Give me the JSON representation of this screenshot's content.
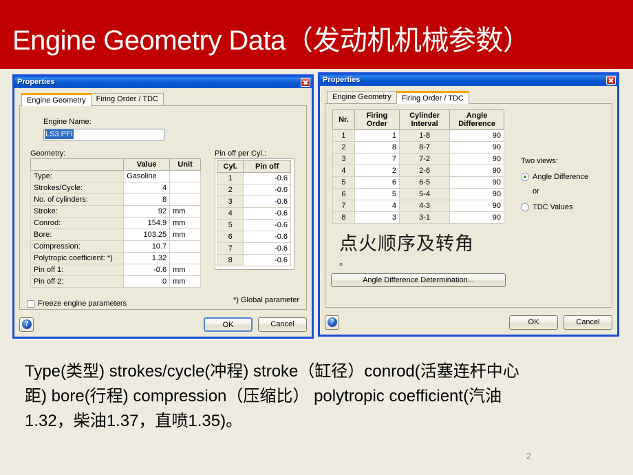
{
  "slide": {
    "title": "Engine Geometry Data（发动机机械参数）",
    "title_color": "#FFFFFF",
    "header_color": "#C00000",
    "background_color": "#EEEBE1",
    "page_number": "2",
    "caption": "Type(类型)  strokes/cycle(冲程) stroke（缸径）conrod(活塞连杆中心距) bore(行程) compression（压缩比） polytropic coefficient(汽油1.32，柴油1.37，直喷1.35)。"
  },
  "left_dialog": {
    "title": "Properties",
    "close_icon": "close-icon",
    "tabs": [
      {
        "label": "Engine Geometry",
        "active": true
      },
      {
        "label": "Firing Order / TDC",
        "active": false
      }
    ],
    "engine_name": {
      "label": "Engine Name:",
      "value": "LS3 PFI",
      "placeholder": ""
    },
    "geometry": {
      "label": "Geometry:",
      "headers": [
        "",
        "Value",
        "Unit"
      ],
      "rows": [
        {
          "name": "Type:",
          "value": "Gasoline",
          "unit": "",
          "value_align": "left"
        },
        {
          "name": "Strokes/Cycle:",
          "value": "4",
          "unit": ""
        },
        {
          "name": "No. of cylinders:",
          "value": "8",
          "unit": ""
        },
        {
          "name": "Stroke:",
          "value": "92",
          "unit": "mm"
        },
        {
          "name": "Conrod:",
          "value": "154.9",
          "unit": "mm"
        },
        {
          "name": "Bore:",
          "value": "103.25",
          "unit": "mm"
        },
        {
          "name": "Compression:",
          "value": "10.7",
          "unit": ""
        },
        {
          "name": "Polytropic coefficient: *)",
          "value": "1.32",
          "unit": ""
        },
        {
          "name": "Pin off 1:",
          "value": "-0.6",
          "unit": "mm"
        },
        {
          "name": "Pin off 2:",
          "value": "0",
          "unit": "mm"
        }
      ]
    },
    "pin_off": {
      "label": "Pin off per Cyl.:",
      "headers": [
        "Cyl.",
        "Pin off"
      ],
      "rows": [
        {
          "cyl": "1",
          "pin_off": "-0.6"
        },
        {
          "cyl": "2",
          "pin_off": "-0.6"
        },
        {
          "cyl": "3",
          "pin_off": "-0.6"
        },
        {
          "cyl": "4",
          "pin_off": "-0.6"
        },
        {
          "cyl": "5",
          "pin_off": "-0.6"
        },
        {
          "cyl": "6",
          "pin_off": "-0.6"
        },
        {
          "cyl": "7",
          "pin_off": "-0.6"
        },
        {
          "cyl": "8",
          "pin_off": "-0.6"
        }
      ]
    },
    "freeze_checkbox": {
      "label": "Freeze engine parameters",
      "checked": false
    },
    "global_note": "*) Global parameter",
    "help_glyph": "?",
    "ok_label": "OK",
    "cancel_label": "Cancel"
  },
  "right_dialog": {
    "title": "Properties",
    "close_icon": "close-icon",
    "tabs": [
      {
        "label": "Engine Geometry",
        "active": false
      },
      {
        "label": "Firing Order / TDC",
        "active": true
      }
    ],
    "firing_table": {
      "headers": [
        "Nr.",
        "Firing Order",
        "Cylinder Interval",
        "Angle Difference"
      ],
      "rows": [
        {
          "nr": "1",
          "firing_order": "1",
          "interval": "1-8",
          "angle_difference": "90"
        },
        {
          "nr": "2",
          "firing_order": "8",
          "interval": "8-7",
          "angle_difference": "90"
        },
        {
          "nr": "3",
          "firing_order": "7",
          "interval": "7-2",
          "angle_difference": "90"
        },
        {
          "nr": "4",
          "firing_order": "2",
          "interval": "2-6",
          "angle_difference": "90"
        },
        {
          "nr": "5",
          "firing_order": "6",
          "interval": "6-5",
          "angle_difference": "90"
        },
        {
          "nr": "6",
          "firing_order": "5",
          "interval": "5-4",
          "angle_difference": "90"
        },
        {
          "nr": "7",
          "firing_order": "4",
          "interval": "4-3",
          "angle_difference": "90"
        },
        {
          "nr": "8",
          "firing_order": "3",
          "interval": "3-1",
          "angle_difference": "90"
        }
      ]
    },
    "annotation": {
      "text": "点火顺序及转角",
      "dot": "。"
    },
    "angle_determination_label": "Angle Difference Determination...",
    "views": {
      "label": "Two views:",
      "or_label": "or",
      "options": [
        {
          "label": "Angle Difference",
          "selected": true
        },
        {
          "label": "TDC Values",
          "selected": false
        }
      ]
    },
    "help_glyph": "?",
    "ok_label": "OK",
    "cancel_label": "Cancel"
  }
}
